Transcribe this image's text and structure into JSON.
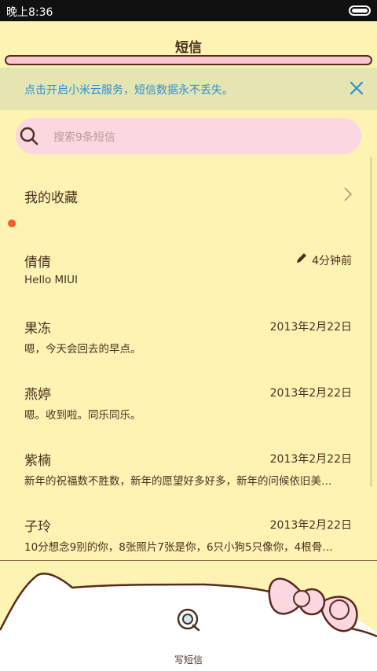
{
  "status_bar": {
    "time": "晚上8:36"
  },
  "header": {
    "title": "短信"
  },
  "banner": {
    "text": "点击开启小米云服务，短信数据永不丢失。"
  },
  "search": {
    "placeholder": "搜索9条短信"
  },
  "favorites": {
    "label": "我的收藏"
  },
  "conversations": [
    {
      "name": "倩倩",
      "time": "4分钟前",
      "preview": "Hello MIUI",
      "draft": true,
      "unread": false
    },
    {
      "name": "果冻",
      "time": "2013年2月22日",
      "preview": "嗯，今天会回去的早点。",
      "draft": false,
      "unread": false
    },
    {
      "name": "燕婷",
      "time": "2013年2月22日",
      "preview": "嗯。收到啦。同乐同乐。",
      "draft": false,
      "unread": true
    },
    {
      "name": "紫楠",
      "time": "2013年2月22日",
      "preview": "新年的祝福数不胜数，新年的愿望好多好多，新年的问候依旧美…",
      "draft": false,
      "unread": false
    },
    {
      "name": "子玲",
      "time": "2013年2月22日",
      "preview": "10分想念9别的你，8张照片7张是你，6只小狗5只像你，4根骨…",
      "draft": false,
      "unread": false
    }
  ],
  "bottom": {
    "compose_label": "写短信"
  },
  "colors": {
    "background": "#fdf3b2",
    "banner_bg": "#e5e5b2",
    "banner_text": "#2d8fd6",
    "search_bg": "#fbd7e0",
    "unread_dot": "#f0622a",
    "text": "#4a3022"
  },
  "icons": [
    "battery-icon",
    "close-icon",
    "search-icon",
    "chevron-right-icon",
    "pencil-icon",
    "compose-icon",
    "bow-decoration"
  ]
}
